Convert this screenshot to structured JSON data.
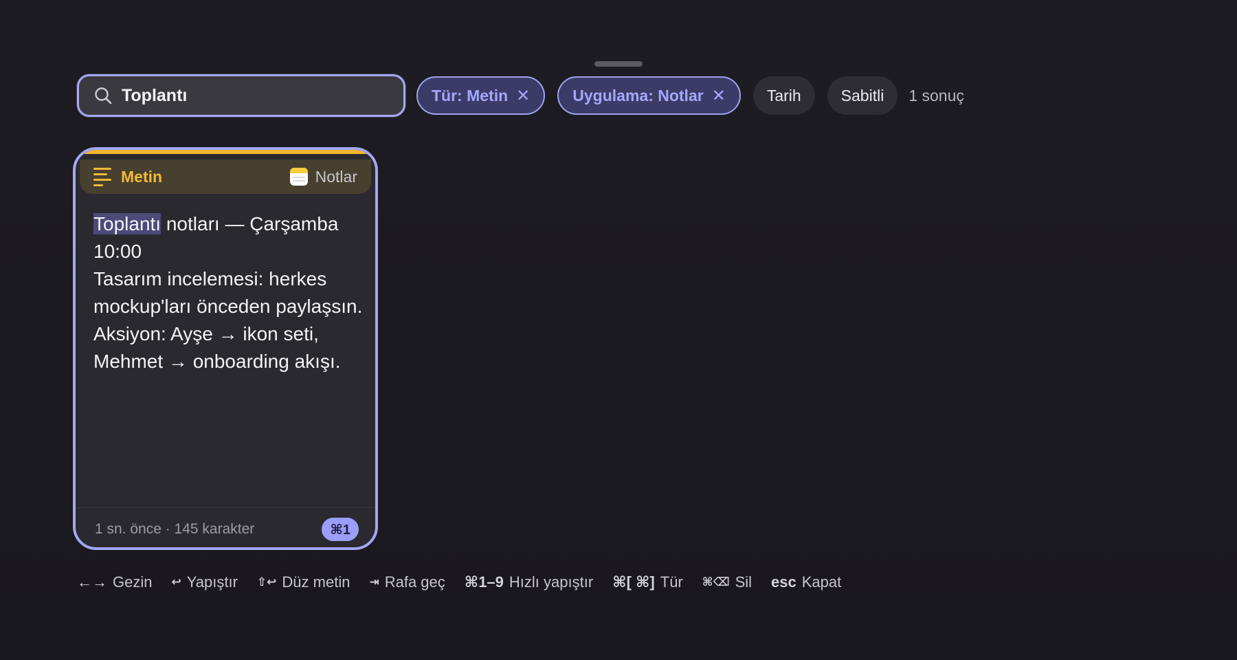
{
  "search": {
    "value": "Toplantı"
  },
  "filters": {
    "active": [
      {
        "label": "Tür: Metin",
        "close": "✕"
      },
      {
        "label": "Uygulama: Notlar",
        "close": "✕"
      }
    ],
    "inactive": [
      {
        "label": "Tarih"
      },
      {
        "label": "Sabitli"
      }
    ],
    "result_count": "1 sonuç"
  },
  "card": {
    "type_label": "Metin",
    "type_icon": "text-lines-icon",
    "app_icon": "notes-app-icon",
    "app_label": "Notlar",
    "highlight": "Toplantı",
    "line1_rest": " notları — Çarşamba 10:00",
    "line2": "Tasarım incelemesi: herkes mockup'ları önceden paylaşsın.",
    "line3": "Aksiyon: Ayşe → ikon seti, Mehmet → onboarding akışı.",
    "meta": "1 sn. önce · 145 karakter",
    "shortcut": "⌘1",
    "accent_color": "#f3b632",
    "selection_color": "#a4a6f4"
  },
  "hints": [
    {
      "key": "←→",
      "label": "Gezin"
    },
    {
      "key": "↩",
      "label": "Yapıştır"
    },
    {
      "key": "⇧↩",
      "label": "Düz metin"
    },
    {
      "key": "⇥",
      "label": "Rafa geç"
    },
    {
      "key": "⌘1–9",
      "label": "Hızlı yapıştır"
    },
    {
      "key": "⌘[ ⌘]",
      "label": "Tür"
    },
    {
      "key": "⌘⌫",
      "label": "Sil"
    },
    {
      "key": "esc",
      "label": "Kapat"
    }
  ]
}
